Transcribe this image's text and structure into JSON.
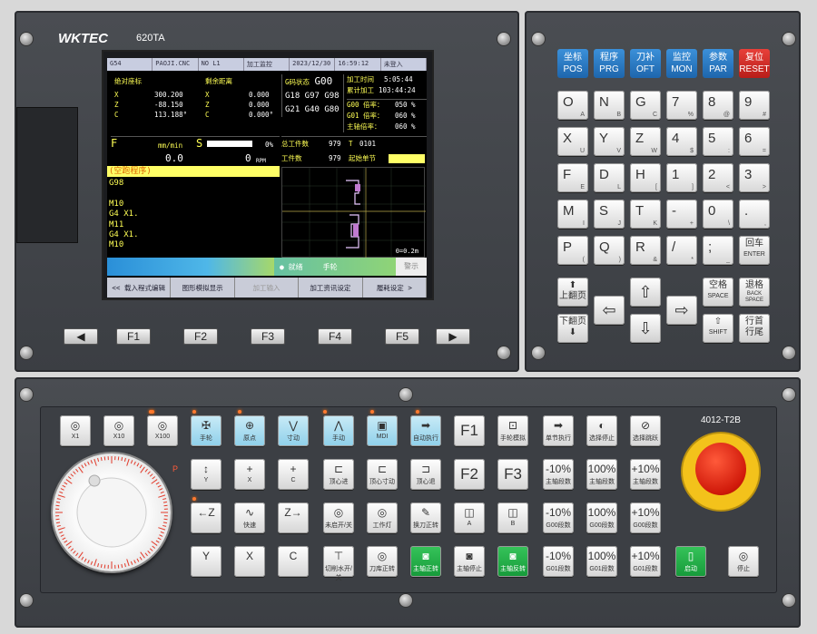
{
  "brand": {
    "logo": "WKTEC",
    "model": "620TA",
    "panel_model": "4012-T2B"
  },
  "lcd": {
    "topbar": [
      "G54",
      "PAOJI.CNC",
      "NO L1",
      "加工监控",
      "2023/12/30",
      "16:59:12",
      "未登入"
    ],
    "coords": {
      "abs_title": "绝对座标",
      "rem_title": "剩余距离",
      "rows": [
        {
          "axis": "X",
          "abs": "300.200",
          "rem_axis": "X",
          "rem": "0.000"
        },
        {
          "axis": "Z",
          "abs": "-88.150",
          "rem_axis": "Z",
          "rem": "0.000"
        },
        {
          "axis": "C",
          "abs": "113.188°",
          "rem_axis": "C",
          "rem": "0.000°"
        }
      ]
    },
    "gstate": {
      "label": "G码状态",
      "g0": "G00",
      "line2": "G18 G97 G98",
      "line3": "G21 G40 G80"
    },
    "times": {
      "proc_label": "加工时间",
      "proc": "5:05:44",
      "total_label": "累计加工",
      "total": "103:44:24"
    },
    "rates": [
      {
        "label": "G00 倍率：",
        "value": "050 %"
      },
      {
        "label": "G01 倍率：",
        "value": "060 %"
      },
      {
        "label": "主轴倍率：",
        "value": "060 %"
      }
    ],
    "feed": {
      "label": "F",
      "unit": "mm/min",
      "value": "0.0",
      "s_label": "S",
      "s_pct": "0%",
      "s_value": "0",
      "s_unit": "RPM"
    },
    "counts": {
      "total_label": "总工件数",
      "total": "979",
      "work_label": "工件数",
      "work": "979",
      "t_label": "T",
      "t_value": "0101",
      "start_label": "起始单节"
    },
    "program": {
      "title": "(空跑程序)",
      "lines": [
        "G98",
        "",
        "M10",
        "G4 X1.",
        "M11",
        "G4 X1.",
        "M10"
      ]
    },
    "graph_scale": "0=0.2m",
    "status": {
      "ready": "● 就绪",
      "mode": "手轮",
      "alarm": "警示"
    },
    "softkeys": [
      "<< 载入程式编辑",
      "图形模拟显示",
      "加工输入",
      "加工资讯设定",
      "履耗设定 >"
    ]
  },
  "fkeys": [
    "◀",
    "F1",
    "F2",
    "F3",
    "F4",
    "F5",
    "▶"
  ],
  "func_keys": [
    {
      "cn": "坐标",
      "en": "POS"
    },
    {
      "cn": "程序",
      "en": "PRG"
    },
    {
      "cn": "刀补",
      "en": "OFT"
    },
    {
      "cn": "监控",
      "en": "MON"
    },
    {
      "cn": "参数",
      "en": "PAR"
    },
    {
      "cn": "复位",
      "en": "RESET"
    }
  ],
  "keypad": [
    [
      {
        "m": "O",
        "s": "A"
      },
      {
        "m": "N",
        "s": "B"
      },
      {
        "m": "G",
        "s": "C"
      },
      {
        "m": "7",
        "s": "%"
      },
      {
        "m": "8",
        "s": "@"
      },
      {
        "m": "9",
        "s": "#"
      }
    ],
    [
      {
        "m": "X",
        "s": "U"
      },
      {
        "m": "Y",
        "s": "V"
      },
      {
        "m": "Z",
        "s": "W"
      },
      {
        "m": "4",
        "s": "$"
      },
      {
        "m": "5",
        "s": ":"
      },
      {
        "m": "6",
        "s": "="
      }
    ],
    [
      {
        "m": "F",
        "s": "E"
      },
      {
        "m": "D",
        "s": "L"
      },
      {
        "m": "H",
        "s": "["
      },
      {
        "m": "1",
        "s": "]"
      },
      {
        "m": "2",
        "s": "<"
      },
      {
        "m": "3",
        "s": ">"
      }
    ],
    [
      {
        "m": "M",
        "s": "I"
      },
      {
        "m": "S",
        "s": "J"
      },
      {
        "m": "T",
        "s": "K"
      },
      {
        "m": "-",
        "s": "+"
      },
      {
        "m": "0",
        "s": "\\"
      },
      {
        "m": ".",
        "s": ","
      }
    ],
    [
      {
        "m": "P",
        "s": "("
      },
      {
        "m": "Q",
        "s": ")"
      },
      {
        "m": "R",
        "s": "&"
      },
      {
        "m": "/",
        "s": "*"
      },
      {
        "m": ";",
        "s": "_"
      },
      {
        "m": "回车",
        "s": "ENTER"
      }
    ]
  ],
  "nav_keys": {
    "pgup": "上翻页",
    "pgdn": "下翻页",
    "space": "空格",
    "space_en": "SPACE",
    "bksp": "退格",
    "bksp_en": "BACK SPACE",
    "shift": "SHIFT",
    "home": "行首",
    "end": "行尾"
  },
  "lower": {
    "row1": [
      {
        "ic": "◎",
        "lb": "X1"
      },
      {
        "ic": "◎",
        "lb": "X10"
      },
      {
        "ic": "◎",
        "lb": "X100"
      },
      {
        "ic": "✠",
        "lb": "手轮",
        "blue": true
      },
      {
        "ic": "⊕",
        "lb": "原点",
        "blue": true
      },
      {
        "ic": "⋁",
        "lb": "寸动",
        "blue": true
      },
      {
        "ic": "⋀",
        "lb": "手动",
        "blue": true
      },
      {
        "ic": "▣",
        "lb": "MDI",
        "blue": true
      },
      {
        "ic": "➡",
        "lb": "自动执行",
        "blue": true
      },
      {
        "ic": "F1",
        "lb": "",
        "big": true
      },
      {
        "ic": "⊡",
        "lb": "手轮模拟"
      },
      {
        "ic": "➡",
        "lb": "单节执行"
      },
      {
        "ic": "◐",
        "lb": "选择停止"
      },
      {
        "ic": "⊘",
        "lb": "选择跳跃"
      }
    ],
    "row2": [
      {
        "ic": "↕",
        "lb": "Y"
      },
      {
        "ic": "+",
        "lb": "X"
      },
      {
        "ic": "+",
        "lb": "C"
      },
      {
        "ic": "⊏",
        "lb": "顶心进"
      },
      {
        "ic": "⊏",
        "lb": "顶心寸动"
      },
      {
        "ic": "⊐",
        "lb": "顶心退"
      },
      {
        "ic": "F2",
        "lb": "",
        "big": true
      },
      {
        "ic": "F3",
        "lb": "",
        "big": true
      },
      {
        "ic": "-10%",
        "lb": "主轴段数"
      },
      {
        "ic": "100%",
        "lb": "主轴段数"
      },
      {
        "ic": "+10%",
        "lb": "主轴段数"
      }
    ],
    "row3": [
      {
        "ic": "←Z",
        "lb": ""
      },
      {
        "ic": "∿",
        "lb": "快速"
      },
      {
        "ic": "Z→",
        "lb": ""
      },
      {
        "ic": "◎",
        "lb": "未启开/关"
      },
      {
        "ic": "◎",
        "lb": "工作灯"
      },
      {
        "ic": "✎",
        "lb": "换刀正转"
      },
      {
        "ic": "◫",
        "lb": "A"
      },
      {
        "ic": "◫",
        "lb": "B"
      },
      {
        "ic": "-10%",
        "lb": "G00段数"
      },
      {
        "ic": "100%",
        "lb": "G00段数"
      },
      {
        "ic": "+10%",
        "lb": "G00段数"
      }
    ],
    "row4": [
      {
        "ic": "Y",
        "lb": ""
      },
      {
        "ic": "X",
        "lb": ""
      },
      {
        "ic": "C",
        "lb": ""
      },
      {
        "ic": "⊤",
        "lb": "切削水开/关"
      },
      {
        "ic": "◎",
        "lb": "刀库正转"
      },
      {
        "ic": "◙",
        "lb": "主轴正转",
        "green": true
      },
      {
        "ic": "◙",
        "lb": "主轴停止"
      },
      {
        "ic": "◙",
        "lb": "主轴反转",
        "green": true
      },
      {
        "ic": "-10%",
        "lb": "G01段数"
      },
      {
        "ic": "100%",
        "lb": "G01段数"
      },
      {
        "ic": "+10%",
        "lb": "G01段数"
      },
      {
        "ic": "▯",
        "lb": "启动",
        "green": true
      },
      {
        "ic": "◎",
        "lb": "停止"
      }
    ]
  },
  "colors": {
    "panel": "#3f4247",
    "lcd_text": "#ffff55",
    "key_blue": "#1e66ad"
  }
}
